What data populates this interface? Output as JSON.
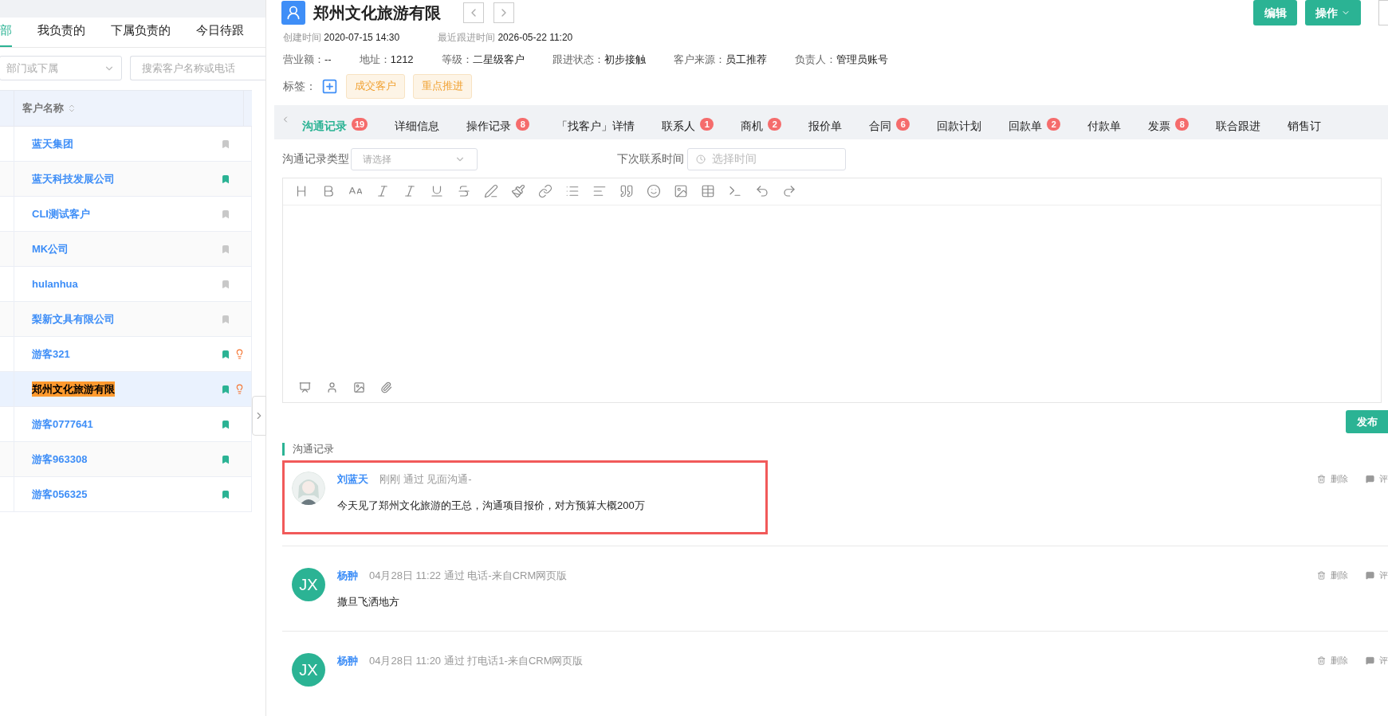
{
  "left_panel": {
    "tabs": [
      {
        "label": "部",
        "selected": true
      },
      {
        "label": "我负责的",
        "selected": false
      },
      {
        "label": "下属负责的",
        "selected": false
      },
      {
        "label": "今日待跟",
        "selected": false
      }
    ],
    "department_filter": {
      "placeholder": "部门或下属"
    },
    "search": {
      "placeholder": "搜索客户名称或电话"
    },
    "table": {
      "columns": [
        {
          "label": "客户名称"
        }
      ],
      "rows": [
        {
          "name": "蓝天集团",
          "selected": false,
          "bookmarked": false,
          "bulb": false
        },
        {
          "name": "蓝天科技发展公司",
          "selected": false,
          "bookmarked": true,
          "bulb": false
        },
        {
          "name": "CLI测试客户",
          "selected": false,
          "bookmarked": false,
          "bulb": false
        },
        {
          "name": "MK公司",
          "selected": false,
          "bookmarked": false,
          "bulb": false
        },
        {
          "name": "hulanhua",
          "selected": false,
          "bookmarked": false,
          "bulb": false
        },
        {
          "name": "梨新文具有限公司",
          "selected": false,
          "bookmarked": false,
          "bulb": false
        },
        {
          "name": "游客321",
          "selected": false,
          "bookmarked": true,
          "bulb": true
        },
        {
          "name": "郑州文化旅游有限",
          "selected": true,
          "bookmarked": true,
          "bulb": true
        },
        {
          "name": "游客0777641",
          "selected": false,
          "bookmarked": true,
          "bulb": false
        },
        {
          "name": "游客963308",
          "selected": false,
          "bookmarked": true,
          "bulb": false
        },
        {
          "name": "游客056325",
          "selected": false,
          "bookmarked": true,
          "bulb": false
        }
      ]
    }
  },
  "customer": {
    "title": "郑州文化旅游有限",
    "buttons": [
      "编辑",
      "操作"
    ],
    "created": {
      "label": "创建时间",
      "value": "2020-07-15 14:30"
    },
    "last_follow": {
      "label": "最近跟进时间",
      "value": "2026-05-22 11:20"
    },
    "fields": [
      {
        "label": "营业额：",
        "value": "--"
      },
      {
        "label": "地址：",
        "value": "1212"
      },
      {
        "label": "等级：",
        "value": "二星级客户"
      },
      {
        "label": "跟进状态：",
        "value": "初步接触"
      },
      {
        "label": "客户来源：",
        "value": "员工推荐"
      },
      {
        "label": "负责人：",
        "value": "管理员账号"
      }
    ],
    "tags_label": "标签：",
    "tags": [
      "成交客户",
      "重点推进"
    ]
  },
  "tabs": [
    {
      "label": "沟通记录",
      "badge": "19",
      "selected": true
    },
    {
      "label": "详细信息",
      "selected": false
    },
    {
      "label": "操作记录",
      "badge": "8",
      "selected": false
    },
    {
      "label": "「找客户」详情",
      "selected": false
    },
    {
      "label": "联系人",
      "badge": "1",
      "selected": false
    },
    {
      "label": "商机",
      "badge": "2",
      "selected": false
    },
    {
      "label": "报价单",
      "selected": false
    },
    {
      "label": "合同",
      "badge": "6",
      "selected": false
    },
    {
      "label": "回款计划",
      "selected": false
    },
    {
      "label": "回款单",
      "badge": "2",
      "selected": false
    },
    {
      "label": "付款单",
      "selected": false
    },
    {
      "label": "发票",
      "badge": "8",
      "selected": false
    },
    {
      "label": "联合跟进",
      "selected": false
    },
    {
      "label": "销售订",
      "selected": false
    }
  ],
  "form": {
    "type_label": "沟通记录类型",
    "type_placeholder": "请选择",
    "next_label": "下次联系时间",
    "next_placeholder": "选择时间"
  },
  "publish_button": "发布",
  "records_title": "沟通记录",
  "records": [
    {
      "author": "刘蓝天",
      "avatar": {
        "kind": "picture"
      },
      "meta": "刚刚 通过 见面沟通-",
      "content": "今天见了郑州文化旅游的王总，沟通项目报价，对方预算大概200万",
      "highlighted": true,
      "actions": [
        "删除",
        "评"
      ]
    },
    {
      "author": "杨翀",
      "avatar": {
        "kind": "initials",
        "text": "JX"
      },
      "meta": "04月28日 11:22 通过 电话-来自CRM网页版",
      "content": "撒旦飞洒地方",
      "highlighted": false,
      "actions": [
        "删除",
        "评"
      ]
    },
    {
      "author": "杨翀",
      "avatar": {
        "kind": "initials",
        "text": "JX"
      },
      "meta": "04月28日 11:20 通过 打电话1-来自CRM网页版",
      "highlighted": false,
      "actions": [
        "删除",
        "评"
      ]
    }
  ]
}
